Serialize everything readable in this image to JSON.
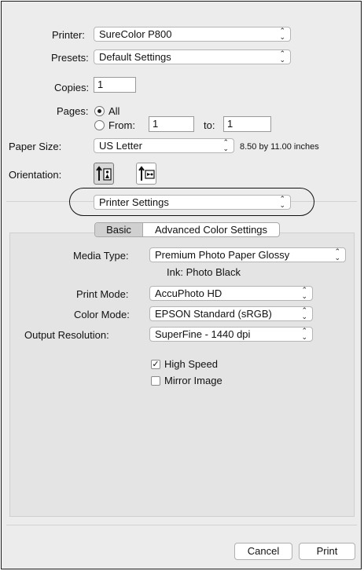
{
  "printer": {
    "label": "Printer:",
    "value": "SureColor P800"
  },
  "presets": {
    "label": "Presets:",
    "value": "Default Settings"
  },
  "copies": {
    "label": "Copies:",
    "value": "1"
  },
  "pages": {
    "label": "Pages:",
    "all_label": "All",
    "from_label": "From:",
    "from_value": "1",
    "to_label": "to:",
    "to_value": "1"
  },
  "paper_size": {
    "label": "Paper Size:",
    "value": "US Letter",
    "dimensions": "8.50 by 11.00 inches"
  },
  "orientation": {
    "label": "Orientation:"
  },
  "section_menu": {
    "value": "Printer Settings"
  },
  "tabs": [
    {
      "label": "Basic"
    },
    {
      "label": "Advanced Color Settings"
    }
  ],
  "settings": {
    "media_type": {
      "label": "Media Type:",
      "value": "Premium Photo Paper Glossy"
    },
    "ink": "Ink: Photo Black",
    "print_mode": {
      "label": "Print Mode:",
      "value": "AccuPhoto HD"
    },
    "color_mode": {
      "label": "Color Mode:",
      "value": "EPSON Standard (sRGB)"
    },
    "output_resolution": {
      "label": "Output Resolution:",
      "value": "SuperFine - 1440 dpi"
    },
    "high_speed": {
      "label": "High Speed",
      "checked": true
    },
    "mirror_image": {
      "label": "Mirror Image",
      "checked": false
    }
  },
  "buttons": {
    "cancel": "Cancel",
    "print": "Print"
  }
}
